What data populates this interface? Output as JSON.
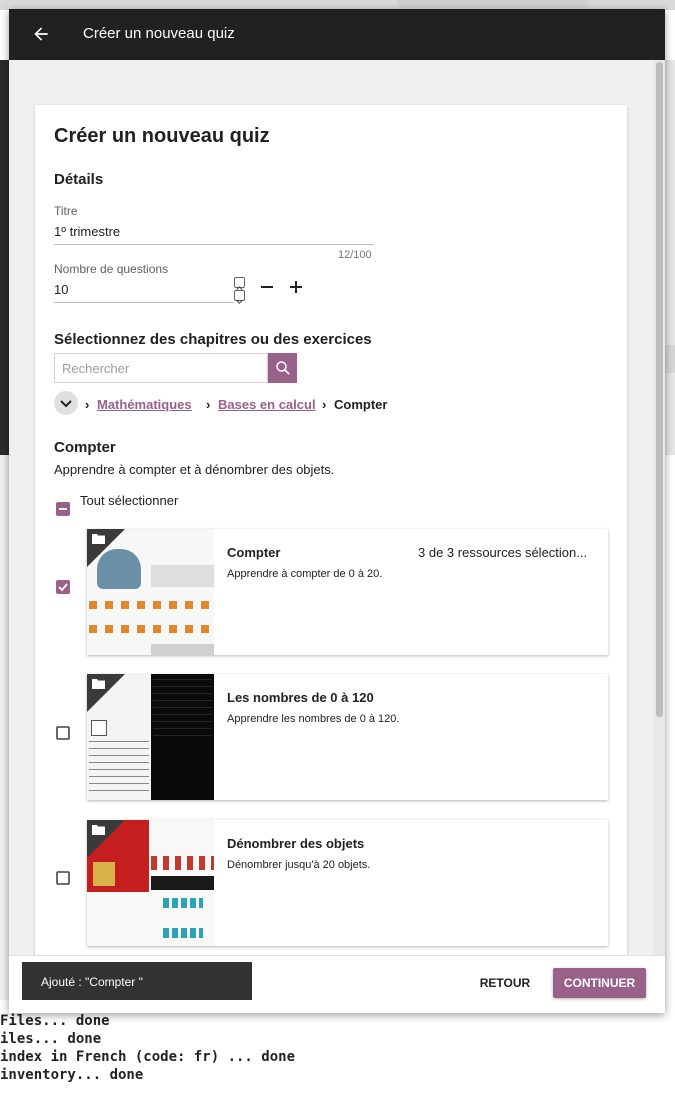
{
  "appbar": {
    "title": "Créer un nouveau quiz"
  },
  "page": {
    "heading": "Créer un nouveau quiz",
    "details_heading": "Détails",
    "title_field": {
      "label": "Titre",
      "value": "1º trimestre",
      "counter": "12/100"
    },
    "questions_field": {
      "label": "Nombre de questions",
      "value": "10"
    },
    "select_heading": "Sélectionnez des chapitres ou des exercices",
    "search": {
      "placeholder": "Rechercher"
    },
    "breadcrumb": {
      "items": [
        "Mathématiques",
        "Bases en calcul",
        "Compter"
      ],
      "sep": "›"
    },
    "topic": {
      "title": "Compter",
      "description": "Apprendre à compter et à dénombrer des objets."
    },
    "select_all": {
      "label": "Tout sélectionner",
      "state": "indeterminate"
    },
    "resources": [
      {
        "title": "Compter",
        "description": "Apprendre à compter de 0 à 20.",
        "count": "3 de 3 ressources sélection...",
        "checked": true
      },
      {
        "title": "Les nombres de 0 à 120",
        "description": "Apprendre les nombres de 0 à 120.",
        "count": "",
        "checked": false
      },
      {
        "title": "Dénombrer des objets",
        "description": "Dénombrer jusqu'à 20 objets.",
        "count": "",
        "checked": false
      }
    ]
  },
  "footer": {
    "snackbar": "Ajouté : \"Compter \"",
    "back_label": "RETOUR",
    "continue_label": "CONTINUER"
  },
  "terminal": {
    "lines": [
      "Files... done",
      "iles... done",
      "index in French (code: fr) ... done",
      "inventory... done"
    ]
  },
  "colors": {
    "accent": "#996189",
    "appbar": "#212121",
    "snackbar": "#323232"
  },
  "icons": [
    "arrow-back-icon",
    "minus-icon",
    "plus-icon",
    "search-icon",
    "chevron-down-icon",
    "folder-icon",
    "checkbox-checked-icon",
    "checkbox-indeterminate-icon"
  ]
}
